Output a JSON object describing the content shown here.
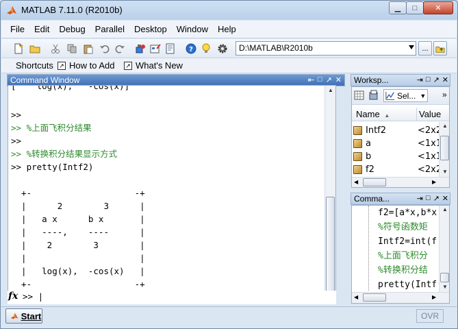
{
  "window": {
    "title": "MATLAB  7.11.0 (R2010b)",
    "controls": {
      "minimize": "▁",
      "maximize": "□",
      "close": "✕"
    }
  },
  "menu": [
    "File",
    "Edit",
    "Debug",
    "Parallel",
    "Desktop",
    "Window",
    "Help"
  ],
  "toolbar": {
    "current_folder": "D:\\MATLAB\\R2010b",
    "browse_label": "...",
    "icons": [
      "new-file-icon",
      "open-folder-icon",
      "cut-icon",
      "copy-icon",
      "paste-icon",
      "undo-icon",
      "redo-icon",
      "simulink-icon",
      "guide-icon",
      "profiler-icon",
      "help-icon",
      "lightbulb-icon",
      "gear-icon"
    ]
  },
  "shortcuts": {
    "label": "Shortcuts",
    "items": [
      "How to Add",
      "What's New"
    ]
  },
  "command_window": {
    "title": "Command Window",
    "lines": [
      {
        "text": "[    log(x),   -cos(x)]",
        "green": false
      },
      {
        "text": "",
        "green": false
      },
      {
        "text": ">>",
        "green": false
      },
      {
        "text": ">> %上面飞积分结果",
        "green": true
      },
      {
        "text": ">>",
        "green": false
      },
      {
        "text": ">> %转换积分结果显示方式",
        "green": true
      },
      {
        "text": ">> pretty(Intf2)",
        "green": false
      },
      {
        "text": "",
        "green": false
      },
      {
        "text": "  +-                    -+",
        "green": false
      },
      {
        "text": "  |      2        3      |",
        "green": false
      },
      {
        "text": "  |   a x      b x       |",
        "green": false
      },
      {
        "text": "  |   ----,    ----      |",
        "green": false
      },
      {
        "text": "  |    2        3        |",
        "green": false
      },
      {
        "text": "  |                      |",
        "green": false
      },
      {
        "text": "  |   log(x),  -cos(x)   |",
        "green": false
      },
      {
        "text": "  +-                    -+",
        "green": false
      }
    ],
    "prompt_icon": "fx",
    "prompt": ">> |"
  },
  "workspace": {
    "title": "Worksp...",
    "select_label": "Sel...",
    "columns": [
      "Name",
      "Value"
    ],
    "rows": [
      {
        "name": "Intf2",
        "value": "<2x2"
      },
      {
        "name": "a",
        "value": "<1x1"
      },
      {
        "name": "b",
        "value": "<1x1"
      },
      {
        "name": "f2",
        "value": "<2x2"
      }
    ]
  },
  "history": {
    "title": "Comma...",
    "lines": [
      {
        "text": "f2=[a*x,b*x",
        "green": false
      },
      {
        "text": "%符号函数矩",
        "green": true
      },
      {
        "text": "Intf2=int(f",
        "green": false
      },
      {
        "text": "%上面飞积分",
        "green": true
      },
      {
        "text": "%转换积分结",
        "green": true
      },
      {
        "text": "pretty(Intf",
        "green": false
      }
    ]
  },
  "status": {
    "start_label": "Start",
    "ovr": "OVR"
  }
}
